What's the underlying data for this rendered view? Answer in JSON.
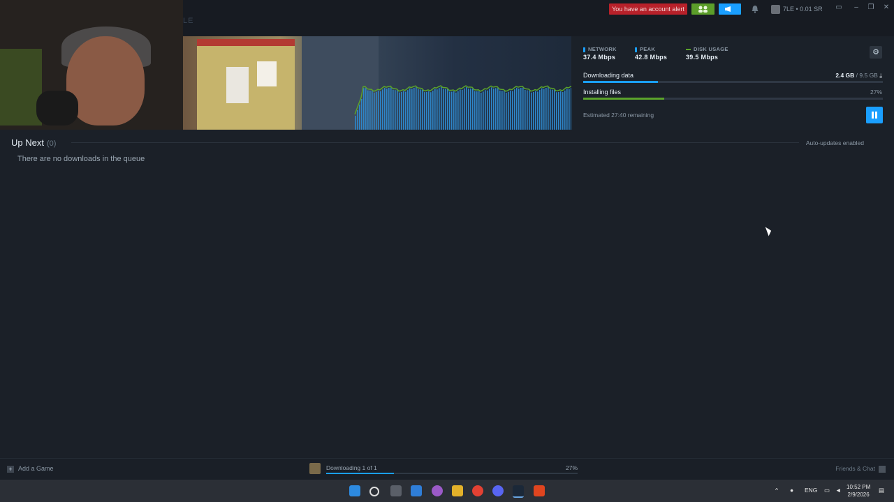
{
  "window": {
    "brand_text": "LE",
    "account_alert_label": "You have an account alert",
    "user_label": "7LE • 0.01 SR",
    "controls": [
      "monitor-icon",
      "minimize-icon",
      "restore-icon",
      "close-icon"
    ]
  },
  "stats": {
    "network": {
      "label": "NETWORK",
      "value": "37.4 Mbps",
      "color": "#1a9fff"
    },
    "peak": {
      "label": "PEAK",
      "value": "42.8 Mbps",
      "color": "#1a9fff"
    },
    "disk": {
      "label": "DISK USAGE",
      "value": "39.5 Mbps",
      "color": "#5ba32b"
    }
  },
  "download": {
    "downloading_label": "Downloading data",
    "downloaded": "2.4 GB",
    "separator": " / ",
    "total": "9.5 GB",
    "download_progress": 0.25,
    "installing_label": "Installing files",
    "installing_pct": "27%",
    "install_progress": 0.27,
    "estimated": "Estimated 27:40 remaining"
  },
  "queue": {
    "title": "Up Next",
    "count": "(0)",
    "auto_updates": "Auto-updates enabled",
    "empty_message": "There are no downloads in the queue"
  },
  "bottom": {
    "add_game": "Add a Game",
    "status": "Downloading 1 of 1",
    "status_pct": "27%",
    "status_progress": 0.27,
    "friends_chat": "Friends & Chat"
  },
  "taskbar": {
    "lang": "ENG",
    "time": "10:52 PM",
    "date": "2/9/2026"
  },
  "colors": {
    "accent": "#1a9fff",
    "alert": "#b8212a",
    "friends": "#5c9e2a",
    "install": "#5ba32b"
  }
}
